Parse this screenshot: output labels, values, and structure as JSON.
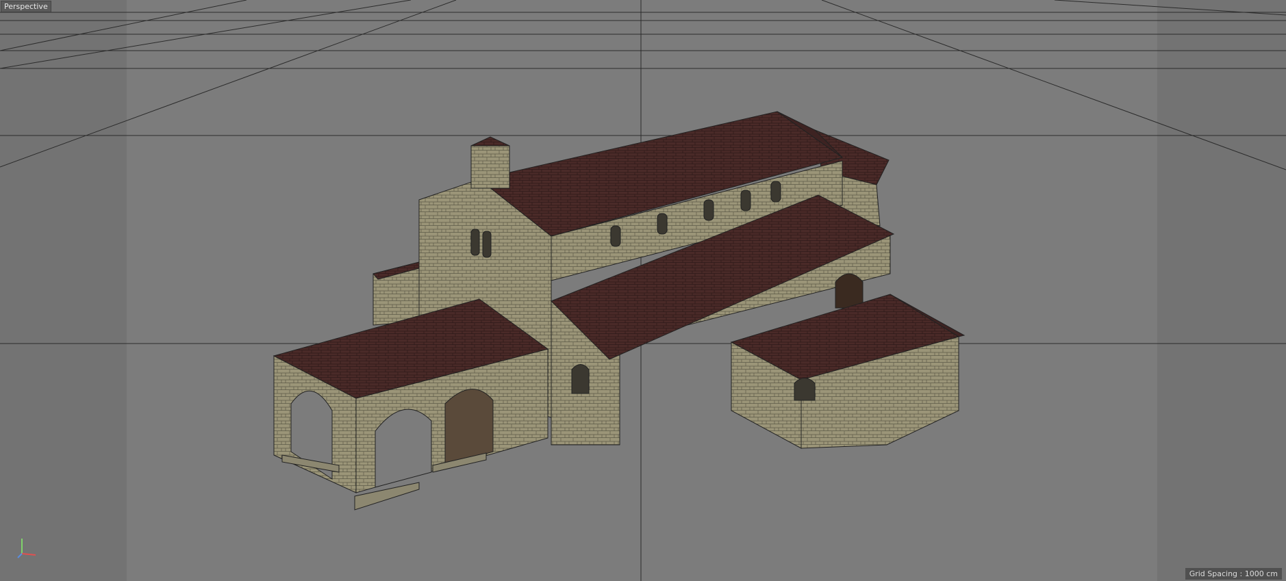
{
  "viewport": {
    "label": "Perspective",
    "grid_spacing": "Grid Spacing : 1000 cm"
  },
  "colors": {
    "background": "#7a7a7a",
    "safe_frame_side": "#6f6f6f",
    "grid_line": "#2a2a2a",
    "roof": "#4a2a28",
    "stone_wall": "#9b9578",
    "stone_dark": "#6e6a55"
  },
  "axis_gizmo": {
    "icon": "xyz-axis-icon"
  }
}
